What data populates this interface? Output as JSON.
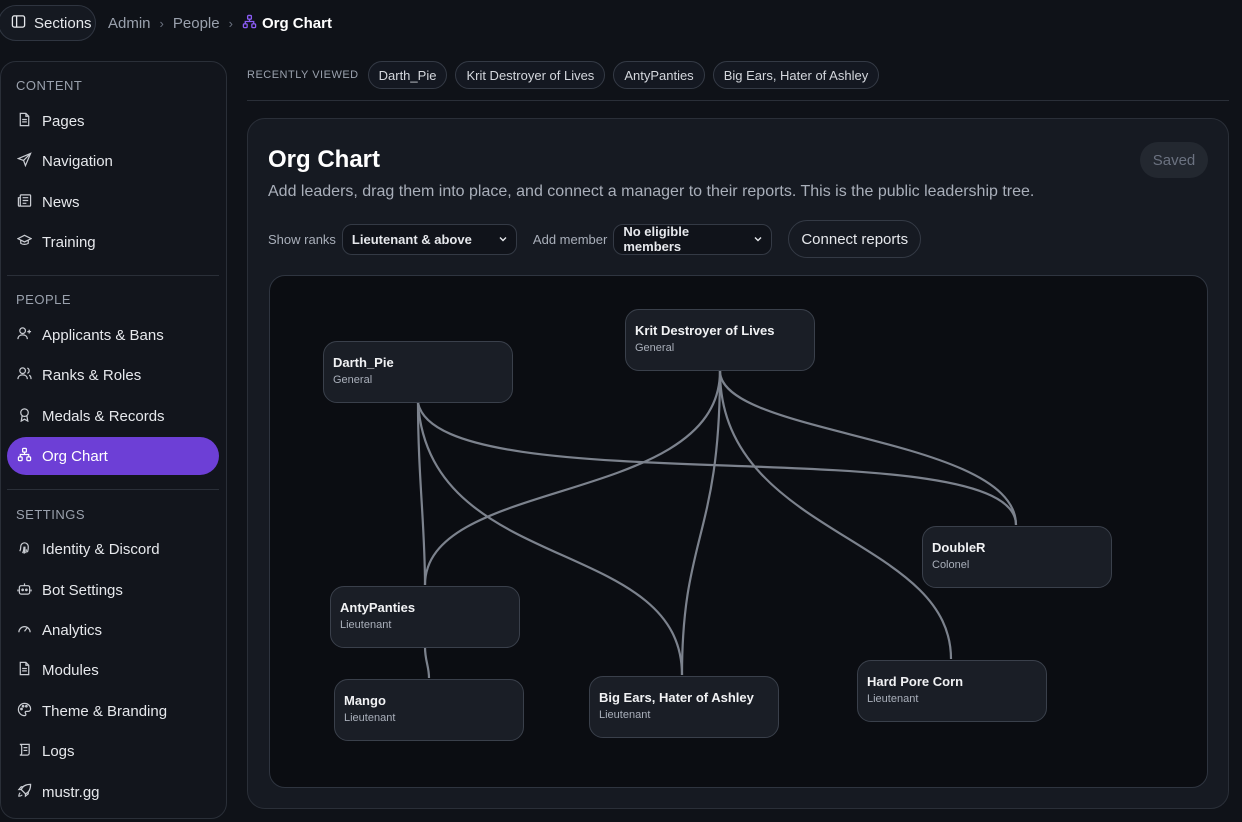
{
  "topbar": {
    "sections_label": "Sections",
    "breadcrumb": [
      "Admin",
      "People",
      "Org Chart"
    ],
    "separator": "›"
  },
  "sidebar": {
    "sections": [
      {
        "label": "CONTENT",
        "items": [
          {
            "label": "Pages",
            "icon": "file-icon"
          },
          {
            "label": "Navigation",
            "icon": "send-icon"
          },
          {
            "label": "News",
            "icon": "newspaper-icon"
          },
          {
            "label": "Training",
            "icon": "graduation-cap-icon"
          }
        ]
      },
      {
        "label": "PEOPLE",
        "items": [
          {
            "label": "Applicants & Bans",
            "icon": "user-plus-icon"
          },
          {
            "label": "Ranks & Roles",
            "icon": "users-icon"
          },
          {
            "label": "Medals & Records",
            "icon": "award-icon"
          },
          {
            "label": "Org Chart",
            "icon": "org-chart-icon",
            "active": true
          }
        ]
      },
      {
        "label": "SETTINGS",
        "items": [
          {
            "label": "Identity & Discord",
            "icon": "fingerprint-icon"
          },
          {
            "label": "Bot Settings",
            "icon": "bot-icon"
          },
          {
            "label": "Analytics",
            "icon": "gauge-icon"
          },
          {
            "label": "Modules",
            "icon": "file-icon"
          },
          {
            "label": "Theme & Branding",
            "icon": "palette-icon"
          },
          {
            "label": "Logs",
            "icon": "scroll-icon"
          },
          {
            "label": "mustr.gg",
            "icon": "rocket-icon"
          }
        ]
      }
    ]
  },
  "recently_viewed": {
    "label": "RECENTLY VIEWED",
    "items": [
      "Darth_Pie",
      "Krit Destroyer of Lives",
      "AntyPanties",
      "Big Ears, Hater of Ashley"
    ]
  },
  "main": {
    "title": "Org Chart",
    "description": "Add leaders, drag them into place, and connect a manager to their reports. This is the public leadership tree.",
    "saved_label": "Saved",
    "show_ranks_label": "Show ranks",
    "show_ranks_value": "Lieutenant & above",
    "add_member_label": "Add member",
    "add_member_value": "No eligible members",
    "connect_label": "Connect reports"
  },
  "org_chart": {
    "nodes": [
      {
        "id": "darth",
        "name": "Darth_Pie",
        "rank": "General"
      },
      {
        "id": "krit",
        "name": "Krit Destroyer of Lives",
        "rank": "General"
      },
      {
        "id": "doubler",
        "name": "DoubleR",
        "rank": "Colonel"
      },
      {
        "id": "anty",
        "name": "AntyPanties",
        "rank": "Lieutenant"
      },
      {
        "id": "mango",
        "name": "Mango",
        "rank": "Lieutenant"
      },
      {
        "id": "bigears",
        "name": "Big Ears, Hater of Ashley",
        "rank": "Lieutenant"
      },
      {
        "id": "hpc",
        "name": "Hard Pore Corn",
        "rank": "Lieutenant"
      }
    ],
    "links": [
      {
        "from": "darth",
        "to": "anty"
      },
      {
        "from": "darth",
        "to": "bigears"
      },
      {
        "from": "darth",
        "to": "doubler"
      },
      {
        "from": "krit",
        "to": "anty"
      },
      {
        "from": "krit",
        "to": "bigears"
      },
      {
        "from": "krit",
        "to": "hpc"
      },
      {
        "from": "krit",
        "to": "doubler"
      },
      {
        "from": "anty",
        "to": "mango"
      }
    ]
  }
}
